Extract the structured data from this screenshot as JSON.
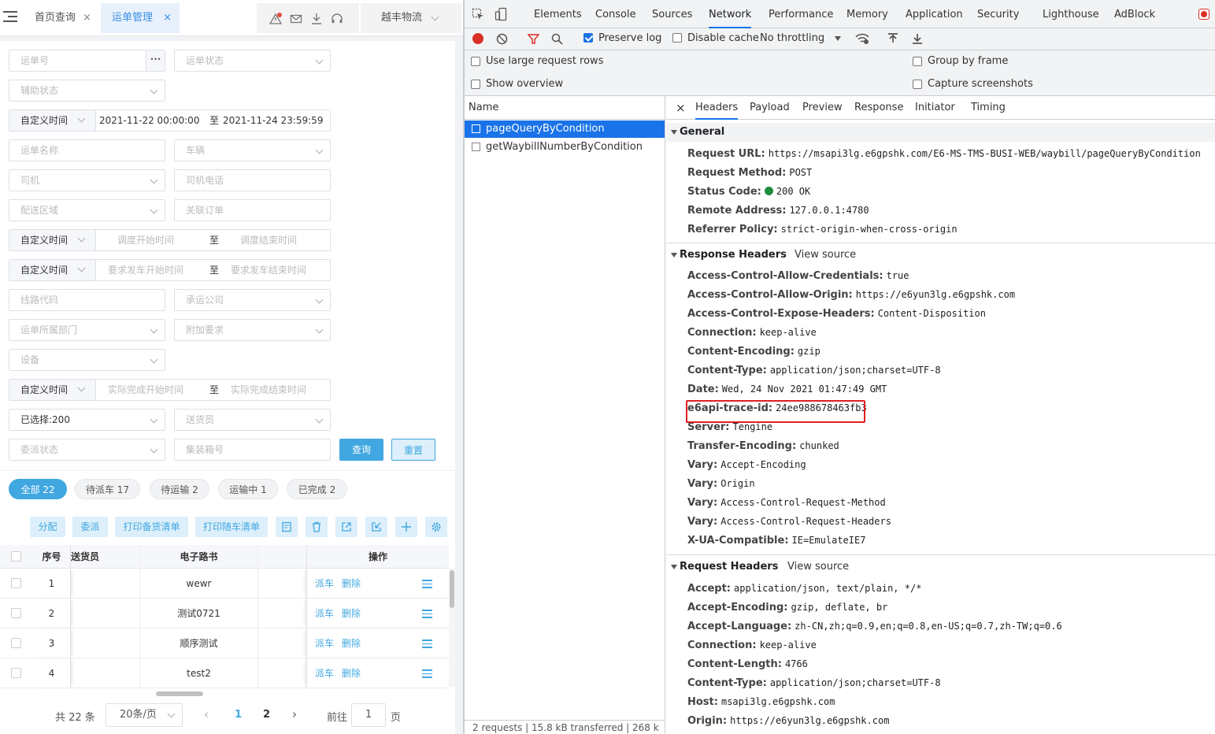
{
  "left_header": {
    "tabs": [
      {
        "label": "首页查询",
        "close": "×"
      },
      {
        "label": "运单管理",
        "close": "×"
      }
    ],
    "org": "越丰物流"
  },
  "form": {
    "waybill_no": "运单号",
    "waybill_status": "运单状态",
    "aux_status": "辅助状态",
    "time1_type": "自定义时间",
    "time1_start": "2021-11-22 00:00:00",
    "time1_sep": "至",
    "time1_end": "2021-11-24 23:59:59",
    "waybill_name": "运单名称",
    "vehicle": "车辆",
    "driver": "司机",
    "driver_phone": "司机电话",
    "delivery_area": "配送区域",
    "related_order": "关联订单",
    "time2_type": "自定义时间",
    "time2_start": "调度开始时间",
    "time2_sep": "至",
    "time2_end": "调度结束时间",
    "time3_type": "自定义时间",
    "time3_start": "要求发车开始时间",
    "time3_sep": "至",
    "time3_end": "要求发车结束时间",
    "route_code": "线路代码",
    "carrier": "承运公司",
    "dept": "运单所属部门",
    "extra_req": "附加要求",
    "device": "设备",
    "time4_type": "自定义时间",
    "time4_start": "实际完成开始时间",
    "time4_sep": "至",
    "time4_end": "实际完成结束时间",
    "selected": "已选择:200",
    "deliverer": "送货员",
    "assign_status": "委派状态",
    "container_no": "集装箱号",
    "query_btn": "查询",
    "reset_btn": "重置"
  },
  "pills": [
    "全部 22",
    "待派车 17",
    "待运输 2",
    "运输中 1",
    "已完成 2"
  ],
  "toolbar": {
    "assign": "分配",
    "delegate": "委派",
    "print_prep": "打印备货清单",
    "print_car": "打印随车清单"
  },
  "table": {
    "headers": {
      "seq": "序号",
      "deliverer": "送货员",
      "route_book": "电子路书",
      "ops": "操作"
    },
    "rows": [
      {
        "seq": "1",
        "route_book": "wewr",
        "dispatch": "派车",
        "delete": "删除"
      },
      {
        "seq": "2",
        "route_book": "测试0721",
        "dispatch": "派车",
        "delete": "删除"
      },
      {
        "seq": "3",
        "route_book": "顺序测试",
        "dispatch": "派车",
        "delete": "删除"
      },
      {
        "seq": "4",
        "route_book": "test2",
        "dispatch": "派车",
        "delete": "删除"
      }
    ]
  },
  "pager": {
    "total": "共 22 条",
    "page_size": "20条/页",
    "page1": "1",
    "page2": "2",
    "goto": "前往",
    "goto_val": "1",
    "page_word": "页"
  },
  "devtools": {
    "tabs": [
      "Elements",
      "Console",
      "Sources",
      "Network",
      "Performance",
      "Memory",
      "Application",
      "Security",
      "Lighthouse",
      "AdBlock"
    ],
    "preserve_log": "Preserve log",
    "disable_cache": "Disable cache",
    "throttling": "No throttling",
    "large_rows": "Use large request rows",
    "show_overview": "Show overview",
    "group_by_frame": "Group by frame",
    "capture_screenshots": "Capture screenshots",
    "name_header": "Name",
    "requests": [
      "pageQueryByCondition",
      "getWaybillNumberByCondition"
    ],
    "status_bar": "2 requests  |  15.8 kB transferred  |  268 k",
    "detail_tabs": [
      "Headers",
      "Payload",
      "Preview",
      "Response",
      "Initiator",
      "Timing"
    ],
    "general_title": "General",
    "general": [
      {
        "k": "Request URL:",
        "v": "https://msapi3lg.e6gpshk.com/E6-MS-TMS-BUSI-WEB/waybill/pageQueryByCondition"
      },
      {
        "k": "Request Method:",
        "v": "POST"
      },
      {
        "k": "Status Code:",
        "v": "200 OK"
      },
      {
        "k": "Remote Address:",
        "v": "127.0.0.1:4780"
      },
      {
        "k": "Referrer Policy:",
        "v": "strict-origin-when-cross-origin"
      }
    ],
    "response_title": "Response Headers",
    "request_title": "Request Headers",
    "view_source": "View source",
    "response": [
      {
        "k": "Access-Control-Allow-Credentials:",
        "v": "true"
      },
      {
        "k": "Access-Control-Allow-Origin:",
        "v": "https://e6yun3lg.e6gpshk.com"
      },
      {
        "k": "Access-Control-Expose-Headers:",
        "v": "Content-Disposition"
      },
      {
        "k": "Connection:",
        "v": "keep-alive"
      },
      {
        "k": "Content-Encoding:",
        "v": "gzip"
      },
      {
        "k": "Content-Type:",
        "v": "application/json;charset=UTF-8"
      },
      {
        "k": "Date:",
        "v": "Wed, 24 Nov 2021 01:47:49 GMT"
      },
      {
        "k": "e6api-trace-id:",
        "v": "24ee988678463fb3"
      },
      {
        "k": "Server:",
        "v": "Tengine"
      },
      {
        "k": "Transfer-Encoding:",
        "v": "chunked"
      },
      {
        "k": "Vary:",
        "v": "Accept-Encoding"
      },
      {
        "k": "Vary:",
        "v": "Origin"
      },
      {
        "k": "Vary:",
        "v": "Access-Control-Request-Method"
      },
      {
        "k": "Vary:",
        "v": "Access-Control-Request-Headers"
      },
      {
        "k": "X-UA-Compatible:",
        "v": "IE=EmulateIE7"
      }
    ],
    "request": [
      {
        "k": "Accept:",
        "v": "application/json, text/plain, */*"
      },
      {
        "k": "Accept-Encoding:",
        "v": "gzip, deflate, br"
      },
      {
        "k": "Accept-Language:",
        "v": "zh-CN,zh;q=0.9,en;q=0.8,en-US;q=0.7,zh-TW;q=0.6"
      },
      {
        "k": "Connection:",
        "v": "keep-alive"
      },
      {
        "k": "Content-Length:",
        "v": "4766"
      },
      {
        "k": "Content-Type:",
        "v": "application/json;charset=UTF-8"
      },
      {
        "k": "Host:",
        "v": "msapi3lg.e6gpshk.com"
      },
      {
        "k": "Origin:",
        "v": "https://e6yun3lg.e6gpshk.com"
      }
    ]
  },
  "colors": {
    "accent": "#41a7e0",
    "devtools_blue": "#1a73e8",
    "highlight_red": "#e02020"
  }
}
